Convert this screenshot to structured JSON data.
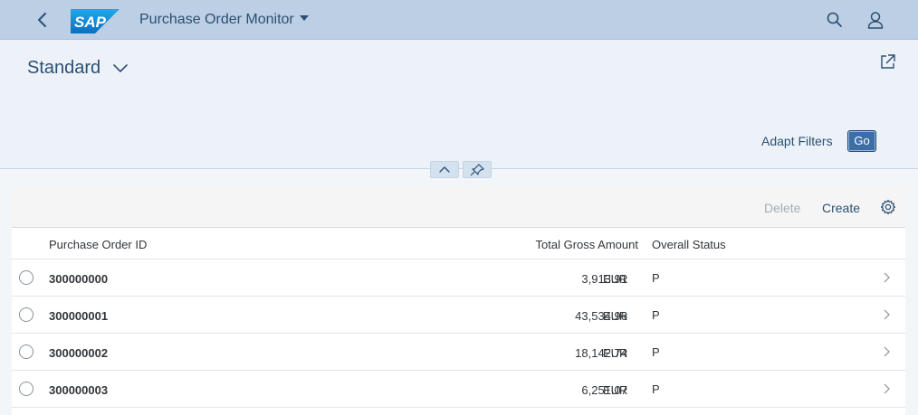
{
  "shell": {
    "app_title": "Purchase Order Monitor",
    "logo_text": "SAP",
    "colors": {
      "shellbar": "#bccfe4",
      "accent": "#2b4f74",
      "logo": "#1a8ed8"
    }
  },
  "header": {
    "variant": "Standard",
    "adapt_filters": "Adapt Filters",
    "go": "Go"
  },
  "toolbar": {
    "delete": "Delete",
    "create": "Create"
  },
  "table": {
    "columns": {
      "id": "Purchase Order ID",
      "amount": "Total Gross Amount",
      "status": "Overall Status"
    },
    "rows": [
      {
        "id": "300000000",
        "amount": "3,913.91",
        "currency": "EUR",
        "status": "P"
      },
      {
        "id": "300000001",
        "amount": "43,534.96",
        "currency": "EUR",
        "status": "P"
      },
      {
        "id": "300000002",
        "amount": "18,142.74",
        "currency": "EUR",
        "status": "P"
      },
      {
        "id": "300000003",
        "amount": "6,251.07",
        "currency": "EUR",
        "status": "P"
      }
    ]
  },
  "icons": [
    "back-icon",
    "sap-logo",
    "search-icon",
    "user-icon",
    "chevron-down-icon",
    "share-icon",
    "chevron-up-icon",
    "pin-icon",
    "settings-icon",
    "radio-icon",
    "chevron-right-icon"
  ]
}
